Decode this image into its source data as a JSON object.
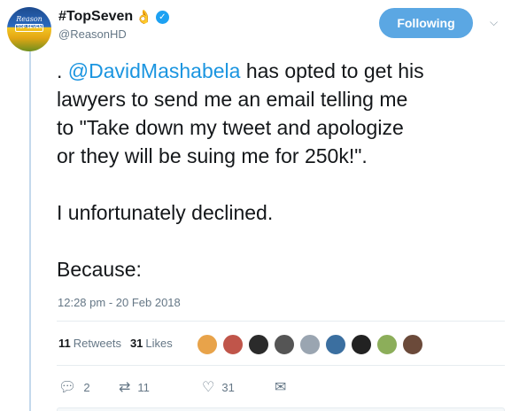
{
  "author": {
    "display_name": "#TopSeven",
    "emoji": "👌",
    "handle": "@ReasonHD",
    "avatar_text_1": "Reason",
    "avatar_text_2": "TOP SEVEN"
  },
  "header": {
    "follow_label": "Following"
  },
  "tweet": {
    "line1_prefix": ". ",
    "mention": "@DavidMashabela",
    "line1_suffix": " has opted to get his",
    "line2": "lawyers to send me an email telling me",
    "line3": "to \"Take down my tweet and apologize",
    "line4": "or they will be suing me for 250k!\".",
    "line5": "I unfortunately declined.",
    "line6": "Because:"
  },
  "timestamp": "12:28 pm - 20 Feb 2018",
  "stats": {
    "retweets_count": "11",
    "retweets_label": "Retweets",
    "likes_count": "31",
    "likes_label": "Likes"
  },
  "likers_colors": [
    "#e8a34a",
    "#c0554a",
    "#2b2b2b",
    "#555555",
    "#9aa5b1",
    "#3b6fa0",
    "#222222",
    "#8cae5a",
    "#6b4a3a"
  ],
  "actions": {
    "reply_count": "2",
    "retweet_count": "11",
    "like_count": "31"
  },
  "colors": {
    "accent": "#1da1f2",
    "link": "#1b95e0",
    "follow_button": "#5ba7e3"
  }
}
